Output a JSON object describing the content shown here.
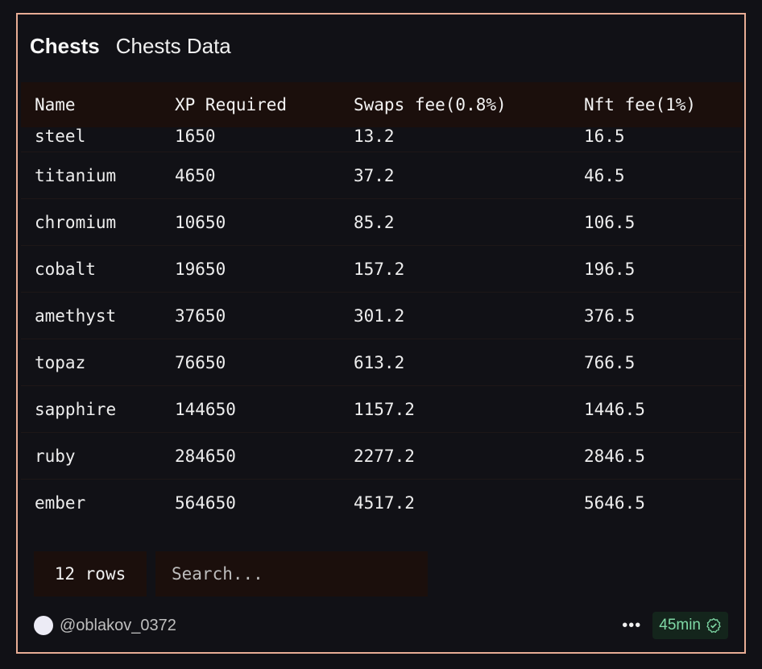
{
  "header": {
    "title": "Chests",
    "subtitle": "Chests Data"
  },
  "table": {
    "columns": [
      "Name",
      "XP Required",
      "Swaps fee(0.8%)",
      "Nft fee(1%)"
    ],
    "rows": [
      [
        "steel",
        "1650",
        "13.2",
        "16.5"
      ],
      [
        "titanium",
        "4650",
        "37.2",
        "46.5"
      ],
      [
        "chromium",
        "10650",
        "85.2",
        "106.5"
      ],
      [
        "cobalt",
        "19650",
        "157.2",
        "196.5"
      ],
      [
        "amethyst",
        "37650",
        "301.2",
        "376.5"
      ],
      [
        "topaz",
        "76650",
        "613.2",
        "766.5"
      ],
      [
        "sapphire",
        "144650",
        "1157.2",
        "1446.5"
      ],
      [
        "ruby",
        "284650",
        "2277.2",
        "2846.5"
      ],
      [
        "ember",
        "564650",
        "4517.2",
        "5646.5"
      ]
    ]
  },
  "controls": {
    "rows_label": "12 rows",
    "search_placeholder": "Search..."
  },
  "footer": {
    "author": "@oblakov_0372",
    "more_label": "•••",
    "time_badge": "45min",
    "icons": [
      "avatar",
      "more-icon",
      "verified-check-icon"
    ]
  },
  "colors": {
    "border": "#e8ad95",
    "background": "#111116",
    "header_row_bg": "#1b0f0c",
    "badge_bg": "#14251c",
    "badge_text": "#7fd9a6"
  }
}
